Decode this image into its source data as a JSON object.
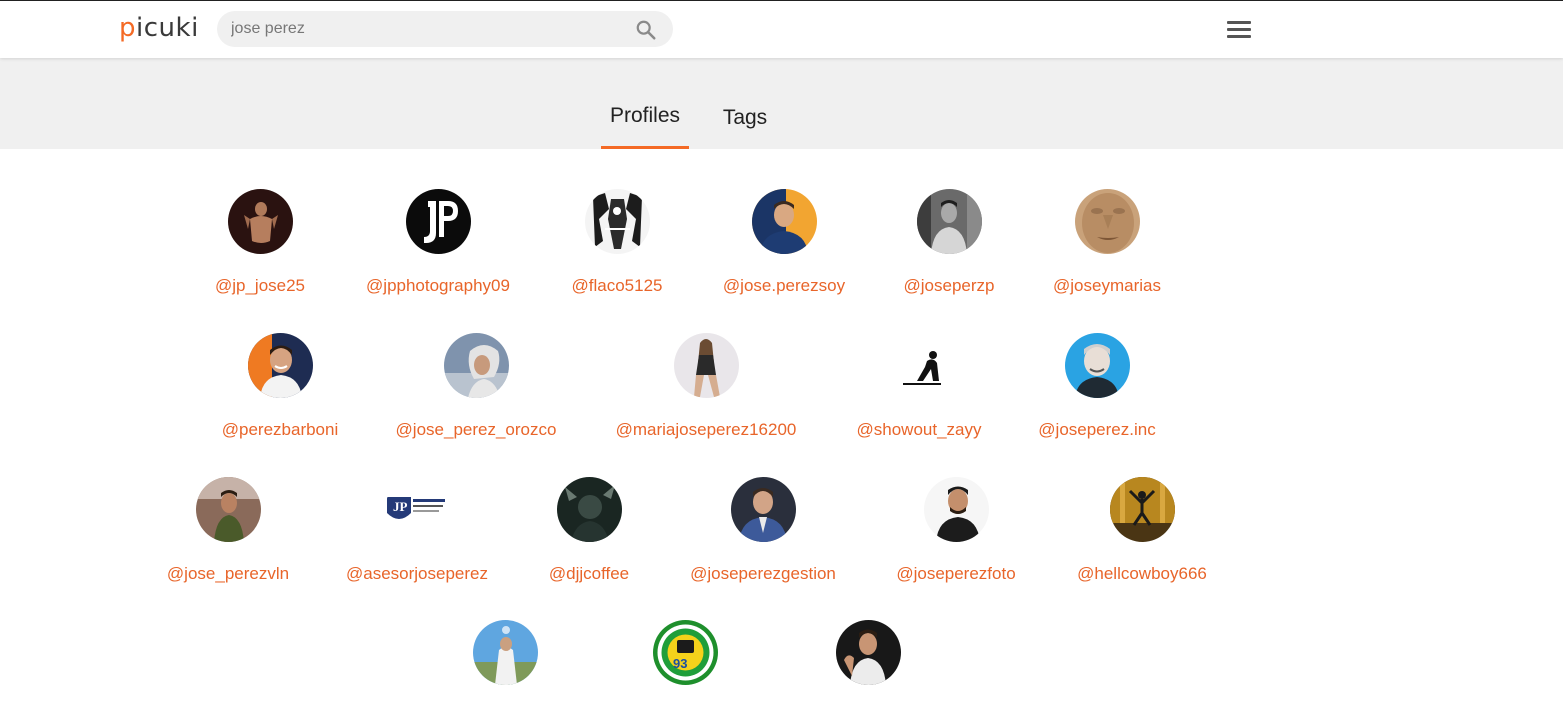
{
  "header": {
    "logo": {
      "first": "p",
      "rest": "icuki"
    },
    "search": {
      "value": "jose perez",
      "placeholder": ""
    }
  },
  "tabs": [
    {
      "label": "Profiles",
      "active": true
    },
    {
      "label": "Tags",
      "active": false
    }
  ],
  "colors": {
    "accent": "#f46a25",
    "link": "#e8652a",
    "band": "#f0f0f0"
  },
  "profiles": [
    {
      "handle": "@jp_jose25"
    },
    {
      "handle": "@jpphotography09"
    },
    {
      "handle": "@flaco5125"
    },
    {
      "handle": "@jose.perezsoy"
    },
    {
      "handle": "@joseperzp"
    },
    {
      "handle": "@joseymarias"
    },
    {
      "handle": "@perezbarboni"
    },
    {
      "handle": "@jose_perez_orozco"
    },
    {
      "handle": "@mariajoseperez16200"
    },
    {
      "handle": "@showout_zayy"
    },
    {
      "handle": "@joseperez.inc"
    },
    {
      "handle": "@jose_perezvln"
    },
    {
      "handle": "@asesorjoseperez"
    },
    {
      "handle": "@djjcoffee"
    },
    {
      "handle": "@joseperezgestion"
    },
    {
      "handle": "@joseperezfoto"
    },
    {
      "handle": "@hellcowboy666"
    },
    {
      "handle": ""
    },
    {
      "handle": ""
    },
    {
      "handle": ""
    }
  ]
}
